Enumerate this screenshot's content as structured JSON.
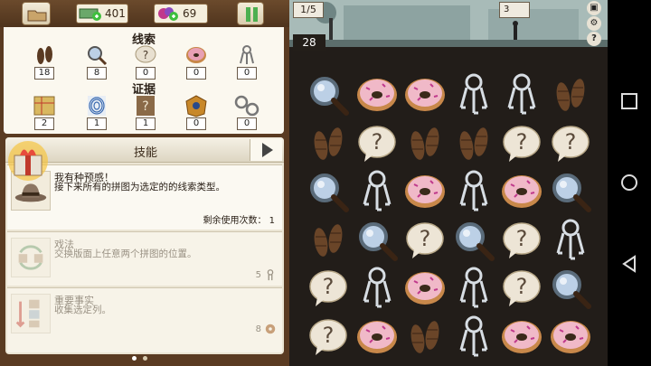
{
  "topbar": {
    "money": "401",
    "gems": "69",
    "icons": [
      "folder-icon",
      "money-icon",
      "gem-icon",
      "pause-icon"
    ]
  },
  "clues": {
    "title": "线索",
    "items": [
      {
        "icon": "footprint-icon",
        "count": "18"
      },
      {
        "icon": "magnifier-icon",
        "count": "8"
      },
      {
        "icon": "question-bubble-icon",
        "count": "0"
      },
      {
        "icon": "donut-icon",
        "count": "0"
      },
      {
        "icon": "keys-icon",
        "count": "0"
      }
    ]
  },
  "evidence": {
    "title": "证据",
    "items": [
      {
        "icon": "map-icon",
        "count": "2"
      },
      {
        "icon": "fingerprint-icon",
        "count": "1"
      },
      {
        "icon": "silhouette-icon",
        "count": "1"
      },
      {
        "icon": "badge-icon",
        "count": "0"
      },
      {
        "icon": "handcuffs-icon",
        "count": "0"
      }
    ]
  },
  "skills": {
    "header": "技能",
    "list": [
      {
        "name": "我有种预感！",
        "desc": "接下来所有的拼图为选定的的线索类型。",
        "uses_label": "剩余使用次数： 1",
        "icon": "detective-hat-icon"
      },
      {
        "name": "戏法",
        "desc": "交换版面上任意两个拼图的位置。",
        "cost": "5",
        "cost_icon": "keys-icon",
        "icon": "swap-icon"
      },
      {
        "name": "重要事实",
        "desc": "收集选定列。",
        "cost": "8",
        "cost_icon": "donut-icon",
        "icon": "column-icon"
      }
    ]
  },
  "board": {
    "pager": "1/5",
    "moves": "28",
    "goal": "3",
    "tiles": [
      [
        "magnifier",
        "donut",
        "donut",
        "keys",
        "keys",
        "footprint"
      ],
      [
        "footprint",
        "question",
        "footprint",
        "footprint",
        "question",
        "question"
      ],
      [
        "magnifier",
        "keys",
        "donut",
        "keys",
        "donut",
        "magnifier"
      ],
      [
        "footprint",
        "magnifier",
        "question",
        "magnifier",
        "question",
        "keys"
      ],
      [
        "question",
        "keys",
        "donut",
        "keys",
        "question",
        "magnifier"
      ],
      [
        "question",
        "donut",
        "footprint",
        "keys",
        "donut",
        "donut"
      ]
    ]
  },
  "navbar": {
    "icons": [
      "recent-apps-icon",
      "home-icon",
      "back-icon"
    ]
  }
}
